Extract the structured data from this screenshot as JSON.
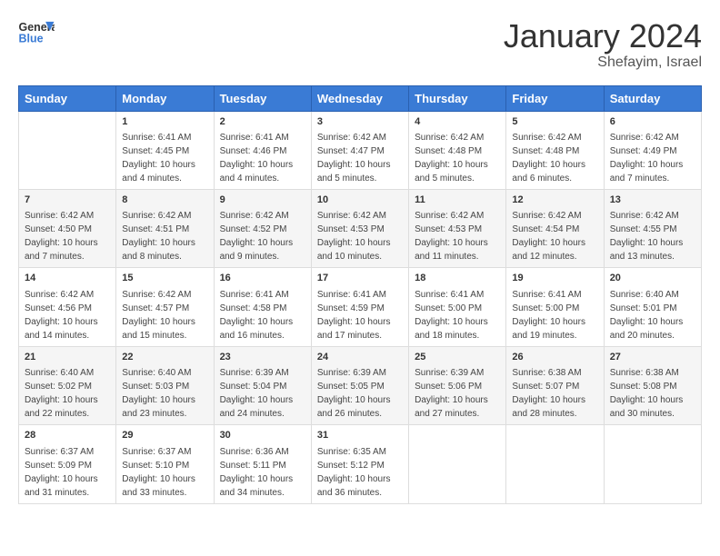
{
  "header": {
    "logo_general": "General",
    "logo_blue": "Blue",
    "month": "January 2024",
    "location": "Shefayim, Israel"
  },
  "weekdays": [
    "Sunday",
    "Monday",
    "Tuesday",
    "Wednesday",
    "Thursday",
    "Friday",
    "Saturday"
  ],
  "weeks": [
    [
      {
        "day": "",
        "content": ""
      },
      {
        "day": "1",
        "content": "Sunrise: 6:41 AM\nSunset: 4:45 PM\nDaylight: 10 hours\nand 4 minutes."
      },
      {
        "day": "2",
        "content": "Sunrise: 6:41 AM\nSunset: 4:46 PM\nDaylight: 10 hours\nand 4 minutes."
      },
      {
        "day": "3",
        "content": "Sunrise: 6:42 AM\nSunset: 4:47 PM\nDaylight: 10 hours\nand 5 minutes."
      },
      {
        "day": "4",
        "content": "Sunrise: 6:42 AM\nSunset: 4:48 PM\nDaylight: 10 hours\nand 5 minutes."
      },
      {
        "day": "5",
        "content": "Sunrise: 6:42 AM\nSunset: 4:48 PM\nDaylight: 10 hours\nand 6 minutes."
      },
      {
        "day": "6",
        "content": "Sunrise: 6:42 AM\nSunset: 4:49 PM\nDaylight: 10 hours\nand 7 minutes."
      }
    ],
    [
      {
        "day": "7",
        "content": "Sunrise: 6:42 AM\nSunset: 4:50 PM\nDaylight: 10 hours\nand 7 minutes."
      },
      {
        "day": "8",
        "content": "Sunrise: 6:42 AM\nSunset: 4:51 PM\nDaylight: 10 hours\nand 8 minutes."
      },
      {
        "day": "9",
        "content": "Sunrise: 6:42 AM\nSunset: 4:52 PM\nDaylight: 10 hours\nand 9 minutes."
      },
      {
        "day": "10",
        "content": "Sunrise: 6:42 AM\nSunset: 4:53 PM\nDaylight: 10 hours\nand 10 minutes."
      },
      {
        "day": "11",
        "content": "Sunrise: 6:42 AM\nSunset: 4:53 PM\nDaylight: 10 hours\nand 11 minutes."
      },
      {
        "day": "12",
        "content": "Sunrise: 6:42 AM\nSunset: 4:54 PM\nDaylight: 10 hours\nand 12 minutes."
      },
      {
        "day": "13",
        "content": "Sunrise: 6:42 AM\nSunset: 4:55 PM\nDaylight: 10 hours\nand 13 minutes."
      }
    ],
    [
      {
        "day": "14",
        "content": "Sunrise: 6:42 AM\nSunset: 4:56 PM\nDaylight: 10 hours\nand 14 minutes."
      },
      {
        "day": "15",
        "content": "Sunrise: 6:42 AM\nSunset: 4:57 PM\nDaylight: 10 hours\nand 15 minutes."
      },
      {
        "day": "16",
        "content": "Sunrise: 6:41 AM\nSunset: 4:58 PM\nDaylight: 10 hours\nand 16 minutes."
      },
      {
        "day": "17",
        "content": "Sunrise: 6:41 AM\nSunset: 4:59 PM\nDaylight: 10 hours\nand 17 minutes."
      },
      {
        "day": "18",
        "content": "Sunrise: 6:41 AM\nSunset: 5:00 PM\nDaylight: 10 hours\nand 18 minutes."
      },
      {
        "day": "19",
        "content": "Sunrise: 6:41 AM\nSunset: 5:00 PM\nDaylight: 10 hours\nand 19 minutes."
      },
      {
        "day": "20",
        "content": "Sunrise: 6:40 AM\nSunset: 5:01 PM\nDaylight: 10 hours\nand 20 minutes."
      }
    ],
    [
      {
        "day": "21",
        "content": "Sunrise: 6:40 AM\nSunset: 5:02 PM\nDaylight: 10 hours\nand 22 minutes."
      },
      {
        "day": "22",
        "content": "Sunrise: 6:40 AM\nSunset: 5:03 PM\nDaylight: 10 hours\nand 23 minutes."
      },
      {
        "day": "23",
        "content": "Sunrise: 6:39 AM\nSunset: 5:04 PM\nDaylight: 10 hours\nand 24 minutes."
      },
      {
        "day": "24",
        "content": "Sunrise: 6:39 AM\nSunset: 5:05 PM\nDaylight: 10 hours\nand 26 minutes."
      },
      {
        "day": "25",
        "content": "Sunrise: 6:39 AM\nSunset: 5:06 PM\nDaylight: 10 hours\nand 27 minutes."
      },
      {
        "day": "26",
        "content": "Sunrise: 6:38 AM\nSunset: 5:07 PM\nDaylight: 10 hours\nand 28 minutes."
      },
      {
        "day": "27",
        "content": "Sunrise: 6:38 AM\nSunset: 5:08 PM\nDaylight: 10 hours\nand 30 minutes."
      }
    ],
    [
      {
        "day": "28",
        "content": "Sunrise: 6:37 AM\nSunset: 5:09 PM\nDaylight: 10 hours\nand 31 minutes."
      },
      {
        "day": "29",
        "content": "Sunrise: 6:37 AM\nSunset: 5:10 PM\nDaylight: 10 hours\nand 33 minutes."
      },
      {
        "day": "30",
        "content": "Sunrise: 6:36 AM\nSunset: 5:11 PM\nDaylight: 10 hours\nand 34 minutes."
      },
      {
        "day": "31",
        "content": "Sunrise: 6:35 AM\nSunset: 5:12 PM\nDaylight: 10 hours\nand 36 minutes."
      },
      {
        "day": "",
        "content": ""
      },
      {
        "day": "",
        "content": ""
      },
      {
        "day": "",
        "content": ""
      }
    ]
  ]
}
